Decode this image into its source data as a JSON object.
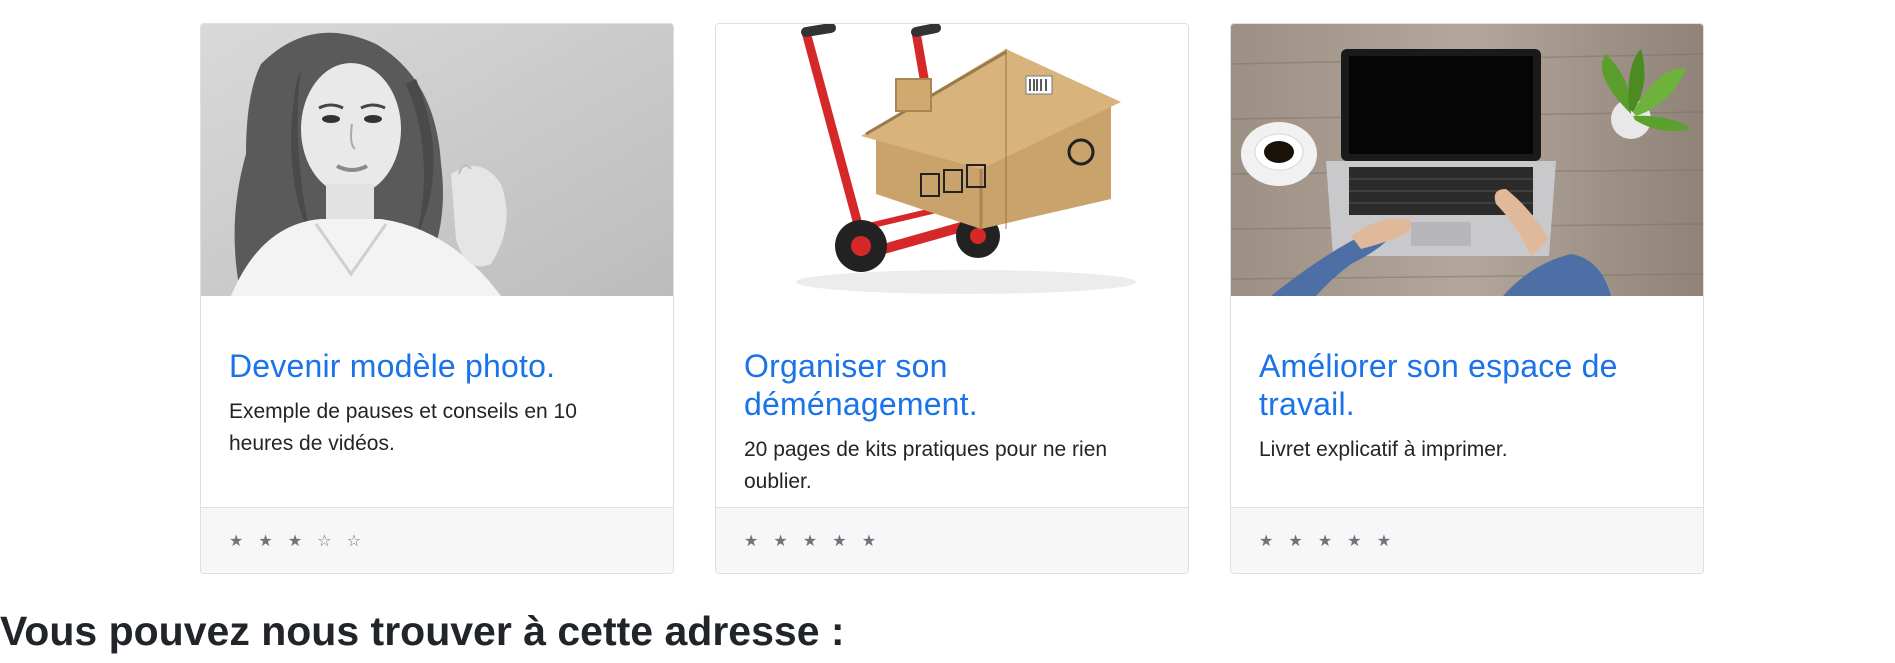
{
  "cards": [
    {
      "title": "Devenir modèle photo.",
      "text": "Exemple de pauses et conseils en 10 heures de vidéos.",
      "rating": "★ ★ ★ ☆ ☆",
      "rating_value": 3,
      "rating_max": 5,
      "image_description": "black-and-white portrait of a woman"
    },
    {
      "title": "Organiser son déménagement.",
      "text": "20 pages de kits pratiques pour ne rien oublier.",
      "rating": "★ ★ ★ ★ ★",
      "rating_value": 5,
      "rating_max": 5,
      "image_description": "red hand truck carrying a house-shaped cardboard box"
    },
    {
      "title": "Améliorer son espace de travail.",
      "text": "Livret explicatif à imprimer.",
      "rating": "★ ★ ★ ★ ★",
      "rating_value": 5,
      "rating_max": 5,
      "image_description": "hands typing on a laptop on a wooden desk with coffee cup and plant"
    }
  ],
  "address": {
    "heading": "Vous pouvez nous trouver à cette adresse :"
  },
  "colors": {
    "title_link": "#1a73e8",
    "text": "#212529",
    "muted": "#6c757d",
    "footer_bg": "#f7f7f7",
    "border": "#dfdfdf"
  }
}
